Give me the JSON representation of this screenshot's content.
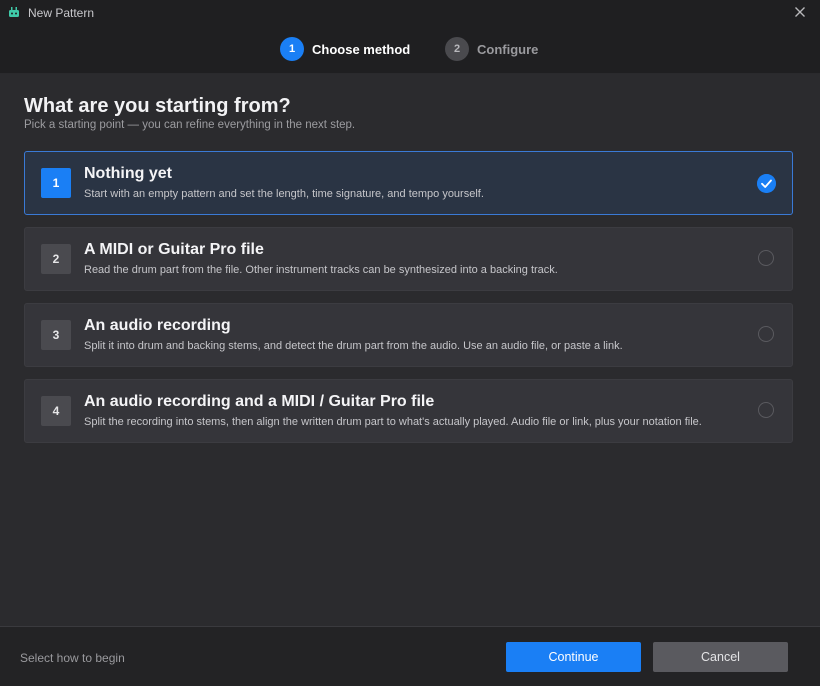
{
  "window": {
    "title": "New Pattern",
    "icon": "drum-app-icon",
    "close_icon": "close-icon"
  },
  "stepper": {
    "steps": [
      {
        "num": "1",
        "label": "Choose method",
        "state": "active"
      },
      {
        "num": "2",
        "label": "Configure",
        "state": "inactive"
      }
    ]
  },
  "page": {
    "heading": "What are you starting from?",
    "subheading": "Pick a starting point — you can refine everything in the next step."
  },
  "options": [
    {
      "num": "1",
      "title": "Nothing yet",
      "desc": "Start with an empty pattern and set the length, time signature, and tempo yourself.",
      "selected": true
    },
    {
      "num": "2",
      "title": "A MIDI or Guitar Pro file",
      "desc": "Read the drum part from the file. Other instrument tracks can be synthesized into a backing track.",
      "selected": false
    },
    {
      "num": "3",
      "title": "An audio recording",
      "desc": "Split it into drum and backing stems, and detect the drum part from the audio. Use an audio file, or paste a link.",
      "selected": false
    },
    {
      "num": "4",
      "title": "An audio recording and a MIDI / Guitar Pro file",
      "desc": "Split the recording into stems, then align the written drum part to what's actually played. Audio file or link, plus your notation file.",
      "selected": false
    }
  ],
  "footer": {
    "status": "Select how to begin",
    "continue_label": "Continue",
    "cancel_label": "Cancel"
  },
  "colors": {
    "accent": "#1a7ff5",
    "selected_bg": "#2a3444",
    "selected_border": "#3a7ad6"
  }
}
